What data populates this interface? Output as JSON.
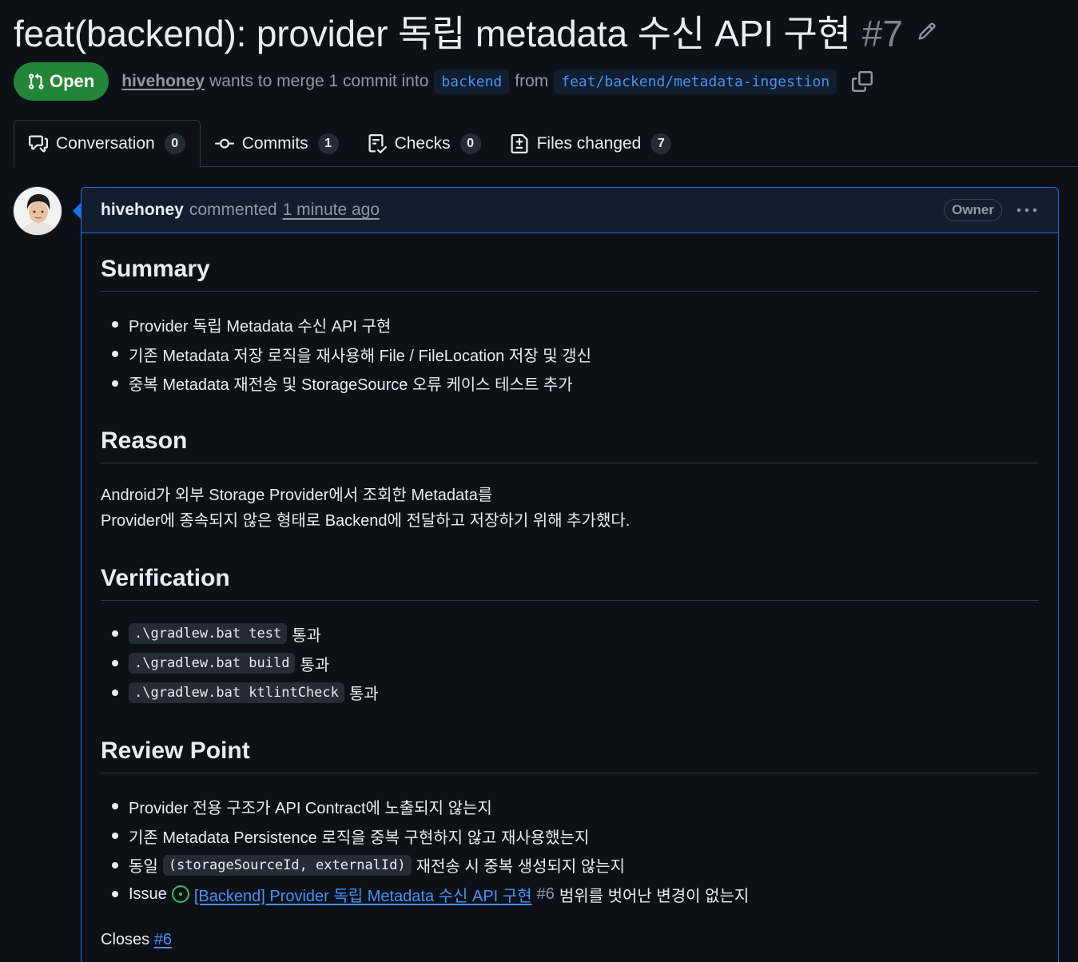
{
  "pr": {
    "title": "feat(backend): provider 독립 metadata 수신 API 구현",
    "number": "#7",
    "state": "Open",
    "author": "hivehoney",
    "merge_text": "wants to merge 1 commit into",
    "base_branch": "backend",
    "from_text": "from",
    "head_branch": "feat/backend/metadata-ingestion"
  },
  "tabs": [
    {
      "label": "Conversation",
      "count": "0"
    },
    {
      "label": "Commits",
      "count": "1"
    },
    {
      "label": "Checks",
      "count": "0"
    },
    {
      "label": "Files changed",
      "count": "7"
    }
  ],
  "comment": {
    "author": "hivehoney",
    "verb": "commented",
    "time": "1 minute ago",
    "badge": "Owner",
    "sections": {
      "summary": {
        "heading": "Summary",
        "items": [
          "Provider 독립 Metadata 수신 API 구현",
          "기존 Metadata 저장 로직을 재사용해 File / FileLocation 저장 및 갱신",
          "중복 Metadata 재전송 및 StorageSource 오류 케이스 테스트 추가"
        ]
      },
      "reason": {
        "heading": "Reason",
        "lines": [
          "Android가 외부 Storage Provider에서 조회한 Metadata를",
          "Provider에 종속되지 않은 형태로 Backend에 전달하고 저장하기 위해 추가했다."
        ]
      },
      "verification": {
        "heading": "Verification",
        "items": [
          {
            "code": ".\\gradlew.bat test",
            "text": "통과"
          },
          {
            "code": ".\\gradlew.bat build",
            "text": "통과"
          },
          {
            "code": ".\\gradlew.bat ktlintCheck",
            "text": "통과"
          }
        ]
      },
      "review": {
        "heading": "Review Point",
        "item1": "Provider 전용 구조가 API Contract에 노출되지 않는지",
        "item2": "기존 Metadata Persistence 로직을 중복 구현하지 않고 재사용했는지",
        "item3_prefix": "동일",
        "item3_code": "(storageSourceId, externalId)",
        "item3_suffix": "재전송 시 중복 생성되지 않는지",
        "item4_prefix": "Issue",
        "item4_link": "[Backend] Provider 독립 Metadata 수신 API 구현",
        "item4_num": "#6",
        "item4_suffix": "범위를 벗어난 변경이 없는지"
      },
      "closes": {
        "text": "Closes",
        "ref": "#6"
      }
    }
  },
  "colors": {
    "open_green": "#238636",
    "link_blue": "#4493f8",
    "accent_border": "#1f6feb",
    "background": "#0d1117"
  }
}
